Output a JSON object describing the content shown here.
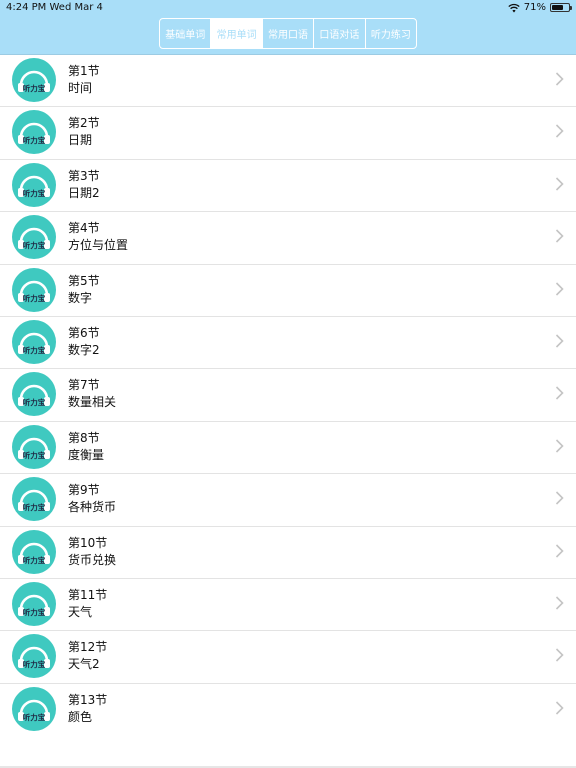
{
  "status": {
    "time": "4:24 PM",
    "date": "Wed Mar 4",
    "battery_percent": "71%",
    "battery_level": 0.71
  },
  "tabs": [
    {
      "label": "基础单词",
      "active": false
    },
    {
      "label": "常用单词",
      "active": true
    },
    {
      "label": "常用口语",
      "active": false
    },
    {
      "label": "口语对话",
      "active": false
    },
    {
      "label": "听力练习",
      "active": false
    }
  ],
  "logo_text": "听力宝",
  "colors": {
    "header": "#a9def8",
    "accent": "#3fc9c0",
    "avatar_text": "#1f2a44"
  },
  "lessons": [
    {
      "title": "第1节",
      "subtitle": "时间"
    },
    {
      "title": "第2节",
      "subtitle": "日期"
    },
    {
      "title": "第3节",
      "subtitle": "日期2"
    },
    {
      "title": "第4节",
      "subtitle": "方位与位置"
    },
    {
      "title": "第5节",
      "subtitle": "数字"
    },
    {
      "title": "第6节",
      "subtitle": "数字2"
    },
    {
      "title": "第7节",
      "subtitle": "数量相关"
    },
    {
      "title": "第8节",
      "subtitle": "度衡量"
    },
    {
      "title": "第9节",
      "subtitle": "各种货币"
    },
    {
      "title": "第10节",
      "subtitle": "货币兑换"
    },
    {
      "title": "第11节",
      "subtitle": "天气"
    },
    {
      "title": "第12节",
      "subtitle": "天气2"
    },
    {
      "title": "第13节",
      "subtitle": "颜色"
    }
  ]
}
